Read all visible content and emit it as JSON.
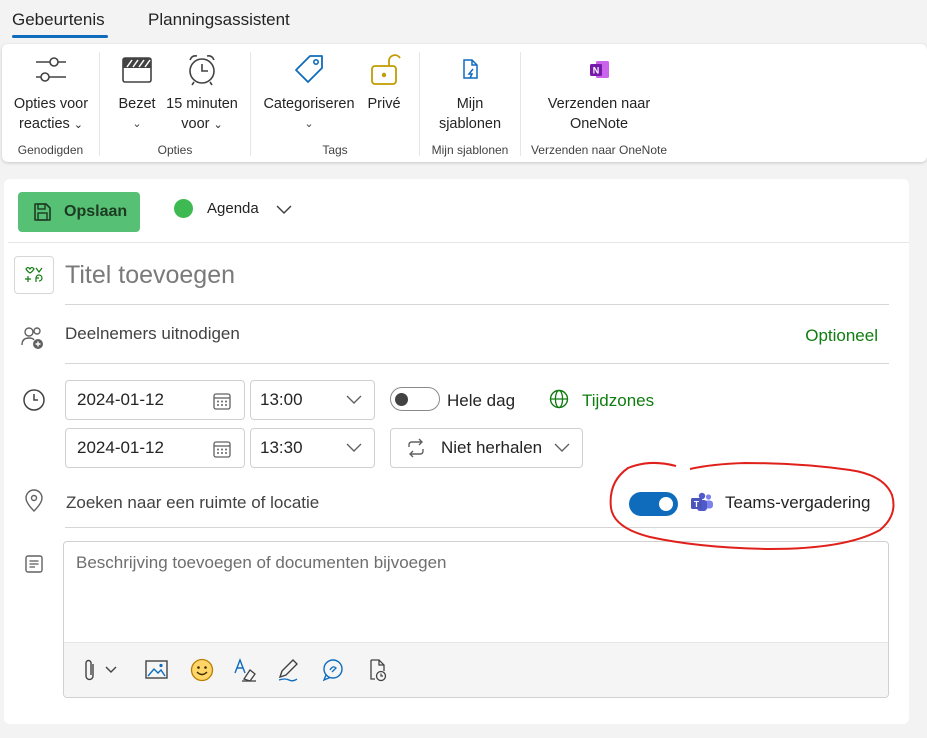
{
  "tabs": [
    {
      "label": "Gebeurtenis",
      "active": true
    },
    {
      "label": "Planningsassistent",
      "active": false
    }
  ],
  "ribbon": {
    "groups": [
      {
        "label": "Genodigden",
        "buttons": [
          {
            "label_line1": "Opties voor",
            "label_line2": "reacties",
            "icon": "sliders-icon"
          }
        ]
      },
      {
        "label": "Opties",
        "buttons": [
          {
            "label_line1": "Bezet",
            "icon": "busy-icon"
          },
          {
            "label_line1": "15 minuten",
            "label_line2": "voor",
            "icon": "alarm-clock-icon"
          }
        ]
      },
      {
        "label": "Tags",
        "buttons": [
          {
            "label_line1": "Categoriseren",
            "icon": "tag-icon"
          },
          {
            "label_line1": "Privé",
            "icon": "lock-icon"
          }
        ]
      },
      {
        "label": "Mijn sjablonen",
        "buttons": [
          {
            "label_line1": "Mijn",
            "label_line2": "sjablonen",
            "icon": "template-icon"
          }
        ]
      },
      {
        "label": "Verzenden naar OneNote",
        "buttons": [
          {
            "label_line1": "Verzenden naar",
            "label_line2": "OneNote",
            "icon": "onenote-icon"
          }
        ]
      }
    ]
  },
  "event": {
    "save_label": "Opslaan",
    "calendar_label": "Agenda",
    "title_placeholder": "Titel toevoegen",
    "attendees_placeholder": "Deelnemers uitnodigen",
    "optional_label": "Optioneel",
    "start_date": "2024-01-12",
    "start_time": "13:00",
    "end_date": "2024-01-12",
    "end_time": "13:30",
    "all_day_label": "Hele dag",
    "all_day_on": false,
    "timezones_label": "Tijdzones",
    "repeat_label": "Niet herhalen",
    "location_placeholder": "Zoeken naar een ruimte of locatie",
    "teams_meeting_label": "Teams-vergadering",
    "teams_meeting_on": true,
    "description_placeholder": "Beschrijving toevoegen of documenten bijvoegen"
  },
  "colors": {
    "accent": "#0f6cbd",
    "save_green": "#56c074",
    "calendar_dot": "#3fb952",
    "link_green": "#107c10",
    "annotation_red": "#e0201b"
  }
}
